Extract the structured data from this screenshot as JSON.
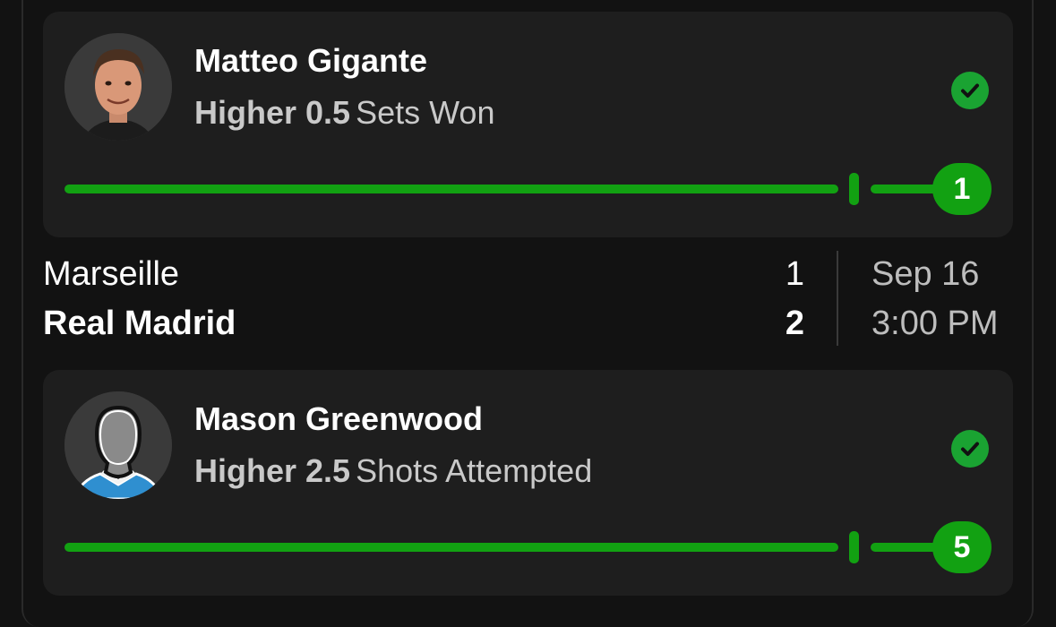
{
  "picks": [
    {
      "player_name": "Matteo Gigante",
      "direction": "Higher 0.5",
      "stat": "Sets Won",
      "result_value": "1",
      "status_icon": "check-circle-icon",
      "avatar_icon": "player-photo",
      "progress_fraction": 1.0
    },
    {
      "player_name": "Mason Greenwood",
      "direction": "Higher 2.5",
      "stat": "Shots Attempted",
      "result_value": "5",
      "status_icon": "check-circle-icon",
      "avatar_icon": "placeholder-player-icon",
      "progress_fraction": 1.0
    }
  ],
  "match": {
    "home_team": "Marseille",
    "away_team": "Real Madrid",
    "home_score": "1",
    "away_score": "2",
    "date": "Sep 16",
    "time": "3:00 PM"
  },
  "colors": {
    "success_green": "#12a112",
    "check_green": "#1aa332",
    "card_bg": "#1e1e1e",
    "page_bg": "#121212"
  }
}
